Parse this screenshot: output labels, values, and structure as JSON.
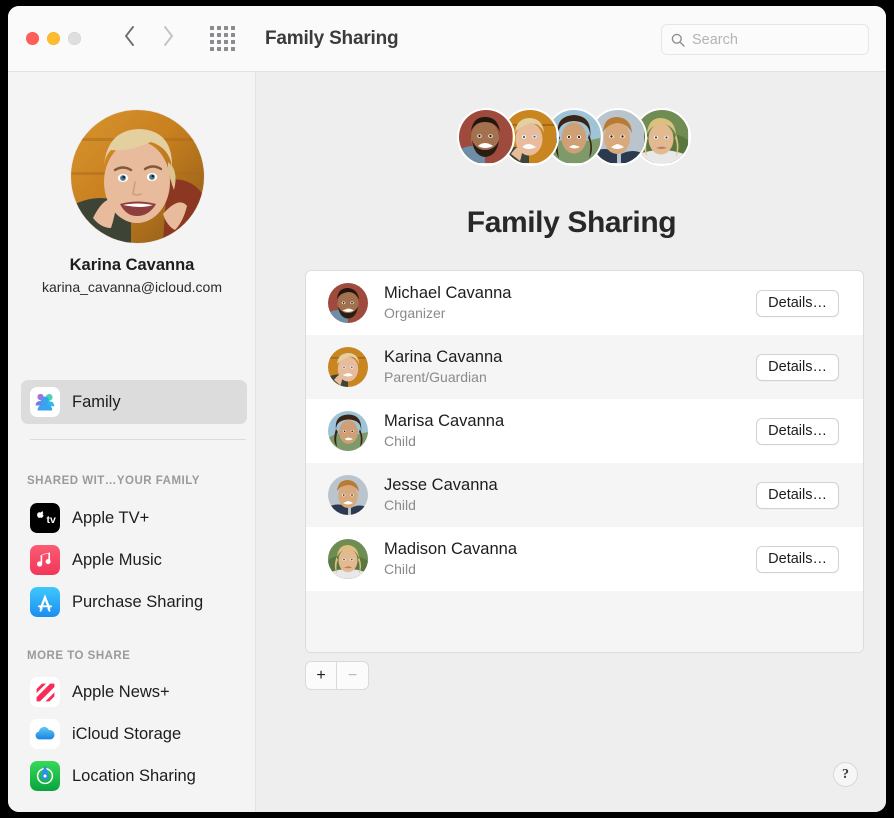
{
  "window": {
    "traffic_lights": [
      "close",
      "minimize",
      "maximize"
    ]
  },
  "toolbar": {
    "back_icon": "chevron-left-icon",
    "forward_icon": "chevron-right-icon",
    "grid_icon": "show-all-grid-icon",
    "title": "Family Sharing"
  },
  "search": {
    "icon": "search-icon",
    "value": "",
    "placeholder": "Search"
  },
  "sidebar": {
    "account": {
      "avatar": "karina-cavanna-avatar",
      "name": "Karina Cavanna",
      "email": "karina_cavanna@icloud.com"
    },
    "selected_item": {
      "icon": "family-icon",
      "label": "Family"
    },
    "sections": [
      {
        "header": "SHARED WIT…YOUR FAMILY",
        "items": [
          {
            "icon": "apple-tv-plus-icon",
            "label": "Apple TV+"
          },
          {
            "icon": "apple-music-icon",
            "label": "Apple Music"
          },
          {
            "icon": "app-store-icon",
            "label": "Purchase Sharing"
          }
        ]
      },
      {
        "header": "MORE TO SHARE",
        "items": [
          {
            "icon": "apple-news-plus-icon",
            "label": "Apple News+"
          },
          {
            "icon": "icloud-storage-icon",
            "label": "iCloud Storage"
          },
          {
            "icon": "find-my-icon",
            "label": "Location Sharing"
          }
        ]
      }
    ]
  },
  "main": {
    "title": "Family Sharing",
    "avatar_strip": [
      "michael-cavanna-avatar",
      "karina-cavanna-avatar",
      "marisa-cavanna-avatar",
      "jesse-cavanna-avatar",
      "madison-cavanna-avatar"
    ],
    "members": [
      {
        "name": "Michael Cavanna",
        "role": "Organizer",
        "details_label": "Details…",
        "avatar": "michael-cavanna-avatar"
      },
      {
        "name": "Karina Cavanna",
        "role": "Parent/Guardian",
        "details_label": "Details…",
        "avatar": "karina-cavanna-avatar"
      },
      {
        "name": "Marisa Cavanna",
        "role": "Child",
        "details_label": "Details…",
        "avatar": "marisa-cavanna-avatar"
      },
      {
        "name": "Jesse Cavanna",
        "role": "Child",
        "details_label": "Details…",
        "avatar": "jesse-cavanna-avatar"
      },
      {
        "name": "Madison Cavanna",
        "role": "Child",
        "details_label": "Details…",
        "avatar": "madison-cavanna-avatar"
      }
    ],
    "add_label": "+",
    "remove_label": "−",
    "help_label": "?"
  },
  "colors": {
    "window_bg": "#eeeeee",
    "sidebar_bg": "#f4f4f4",
    "toolbar_bg": "#fafafa",
    "list_bg": "#ffffff",
    "row_alt_bg": "#f5f5f5",
    "selected_row_bg": "#dcdcdc",
    "secondary_text": "#8a8a8e",
    "traffic_close": "#ff5f57",
    "traffic_min": "#fdbc2e",
    "traffic_max": "#dedede"
  }
}
